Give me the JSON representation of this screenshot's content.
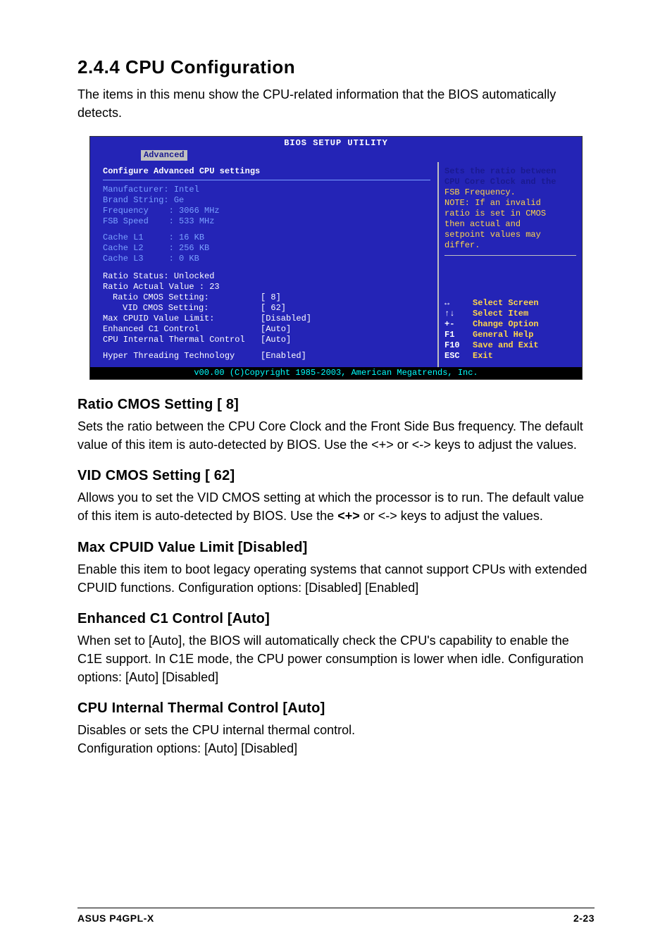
{
  "section": {
    "number_title": "2.4.4   CPU Configuration",
    "intro": "The items in this menu show the CPU-related information that the BIOS automatically detects."
  },
  "bios": {
    "title": "BIOS SETUP UTILITY",
    "tab": "Advanced",
    "headline": "Configure Advanced CPU settings",
    "info": {
      "manufacturer": "Manufacturer: Intel",
      "brand": "Brand String: Ge",
      "frequency": "Frequency    : 3066 MHz",
      "fsb": "FSB Speed    : 533 MHz",
      "l1": "Cache L1     : 16 KB",
      "l2": "Cache L2     : 256 KB",
      "l3": "Cache L3     : 0 KB"
    },
    "status": {
      "ratio_status": "Ratio Status: Unlocked",
      "ratio_actual": "Ratio Actual Value : 23"
    },
    "settings": [
      {
        "label": "Ratio CMOS Setting:",
        "value": "[ 8]",
        "indent": 1
      },
      {
        "label": "VID CMOS Setting:",
        "value": "[ 62]",
        "indent": 2
      },
      {
        "label": "Max CPUID Value Limit:",
        "value": "[Disabled]",
        "indent": 0
      },
      {
        "label": "Enhanced C1 Control",
        "value": "[Auto]",
        "indent": 0
      },
      {
        "label": "CPU Internal Thermal Control",
        "value": "[Auto]",
        "indent": 0
      },
      {
        "label": "Hyper Threading Technology",
        "value": "[Enabled]",
        "indent": 0,
        "gap": true
      }
    ],
    "help": {
      "line1": "Sets the ratio between",
      "line2": "CPU Core Clock and the",
      "line3": "FSB Frequency.",
      "line4": "NOTE: If an invalid",
      "line5": "ratio is set in CMOS",
      "line6": "then actual and",
      "line7": "setpoint values may",
      "line8": "differ."
    },
    "nav": [
      {
        "key": "↔",
        "desc": "Select Screen"
      },
      {
        "key": "↑↓",
        "desc": "Select Item"
      },
      {
        "key": "+-",
        "desc": "Change Option"
      },
      {
        "key": "F1",
        "desc": "General Help"
      },
      {
        "key": "F10",
        "desc": "Save and Exit"
      },
      {
        "key": "ESC",
        "desc": "Exit"
      }
    ],
    "footer": "v00.00 (C)Copyright 1985-2003, American Megatrends, Inc."
  },
  "subsections": {
    "ratio": {
      "title": "Ratio CMOS Setting [ 8]",
      "body": "Sets the ratio between the CPU Core Clock and the Front Side Bus frequency. The default value of this item is auto-detected by BIOS. Use the <+> or <-> keys to adjust the values."
    },
    "vid": {
      "title": "VID CMOS Setting [ 62]",
      "body_a": "Allows you to set the VID CMOS setting at which the processor is to run. The default value of this item is auto-detected by BIOS. Use the ",
      "body_bold": "<+>",
      "body_b": " or <-> keys to adjust the values."
    },
    "cpuid": {
      "title": "Max CPUID Value Limit [Disabled]",
      "body": "Enable this item to boot legacy operating systems that cannot support CPUs with extended CPUID functions. Configuration options: [Disabled] [Enabled]"
    },
    "c1": {
      "title": "Enhanced C1 Control [Auto]",
      "body": "When set to [Auto], the BIOS will automatically check the CPU's capability to enable the C1E support. In C1E mode, the CPU power consumption is lower when idle. Configuration options: [Auto] [Disabled]"
    },
    "thermal": {
      "title": "CPU Internal Thermal Control [Auto]",
      "body_a": "Disables or sets the CPU internal thermal control.",
      "body_b": "Configuration options: [Auto] [Disabled]"
    }
  },
  "footer": {
    "left": "ASUS P4GPL-X",
    "right": "2-23"
  }
}
